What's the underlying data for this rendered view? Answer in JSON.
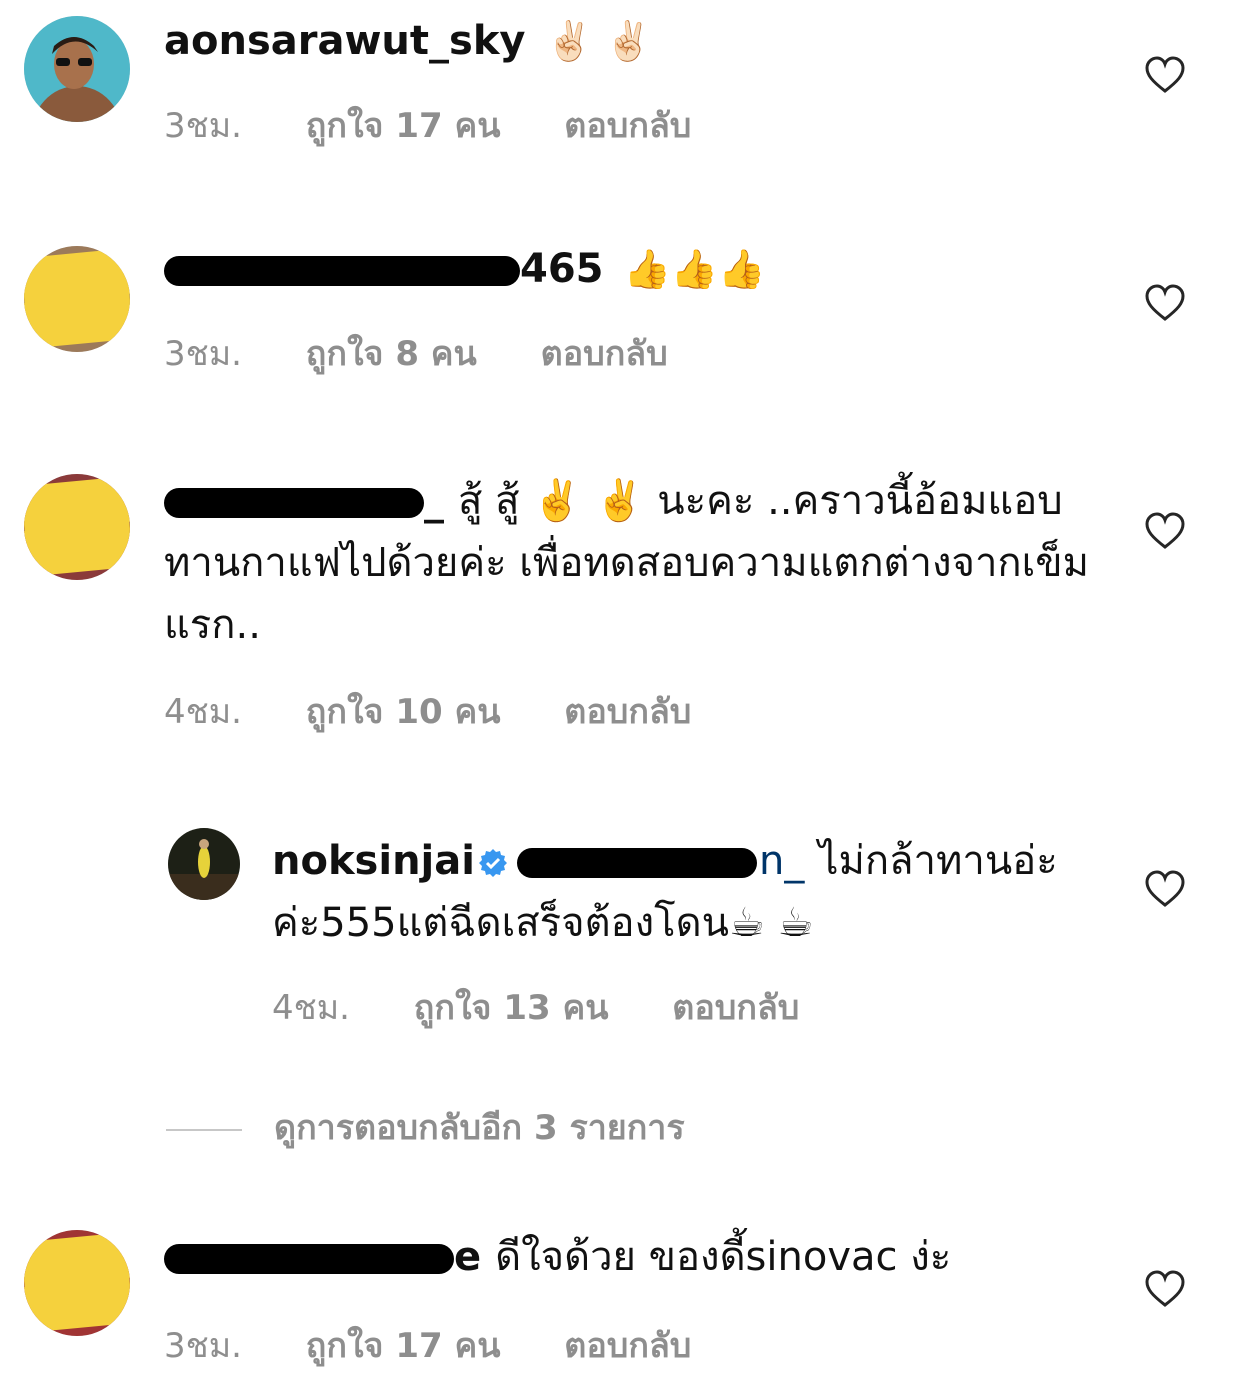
{
  "comments": [
    {
      "username": "aonsarawut_sky",
      "text": "✌🏻 ✌🏻",
      "time": "3ชม.",
      "likes": "ถูกใจ 17 คน",
      "reply": "ตอบกลับ"
    },
    {
      "username_visible_suffix": "465",
      "text": "👍👍👍",
      "time": "3ชม.",
      "likes": "ถูกใจ 8 คน",
      "reply": "ตอบกลับ"
    },
    {
      "username_visible_suffix": "_",
      "text": "สู้ สู้ ✌️ ✌️ นะคะ ..คราวนี้อ้อมแอบทานกาแฟไปด้วยค่ะ เพื่อทดสอบความแตกต่างจากเข็มแรก..",
      "time": "4ชม.",
      "likes": "ถูกใจ 10 คน",
      "reply": "ตอบกลับ"
    },
    {
      "username": "noksinjai",
      "mention_visible_suffix": "n_",
      "text": "ไม่กล้าทานอ่ะค่ะ555แต่ฉีดเสร็จต้องโดน☕ ☕",
      "time": "4ชม.",
      "likes": "ถูกใจ 13 คน",
      "reply": "ตอบกลับ"
    },
    {
      "username_visible_suffix": "e",
      "text": "ดีใจด้วย ของดี้sinovac ง่ะ",
      "time": "3ชม.",
      "likes": "ถูกใจ 17 คน",
      "reply": "ตอบกลับ"
    }
  ],
  "view_more_replies": "ดูการตอบกลับอีก 3 รายการ",
  "colors": {
    "meta": "#8e8e8e",
    "verified": "#3897f0",
    "scribble": "#f5d13d"
  },
  "icons": {
    "like": "heart-icon",
    "verified": "verified-badge-icon"
  }
}
